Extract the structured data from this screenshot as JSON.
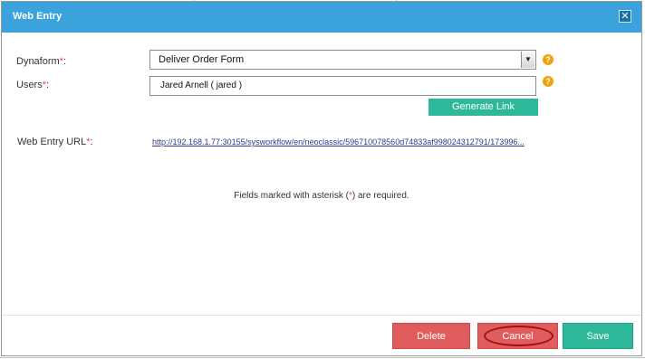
{
  "dialog": {
    "title": "Web Entry",
    "close_glyph": "✕",
    "close_icon": "close-icon"
  },
  "form": {
    "dynaform_label": "Dynaform",
    "dynaform_suffix": ":",
    "dynaform_value": "Deliver Order Form",
    "users_label": "Users",
    "users_suffix": ":",
    "users_value": "Jared Arnell ( jared )",
    "asterisk": "*",
    "help_glyph": "?",
    "generate_link_label": "Generate Link",
    "url_label": "Web Entry URL",
    "url_suffix": ":",
    "url_value": "http://192.168.1.77:30155/sysworkflow/en/neoclassic/596710078560d74833af998024312791/173996...",
    "required_note_before": "Fields marked with asterisk (",
    "required_note_star": "*",
    "required_note_after": ") are required."
  },
  "footer": {
    "delete_label": "Delete",
    "cancel_label": "Cancel",
    "save_label": "Save"
  },
  "colors": {
    "titlebar": "#3ba3dc",
    "danger": "#e15d5d",
    "success": "#2eb89a",
    "help": "#f0a30a",
    "required": "#e0493f"
  }
}
